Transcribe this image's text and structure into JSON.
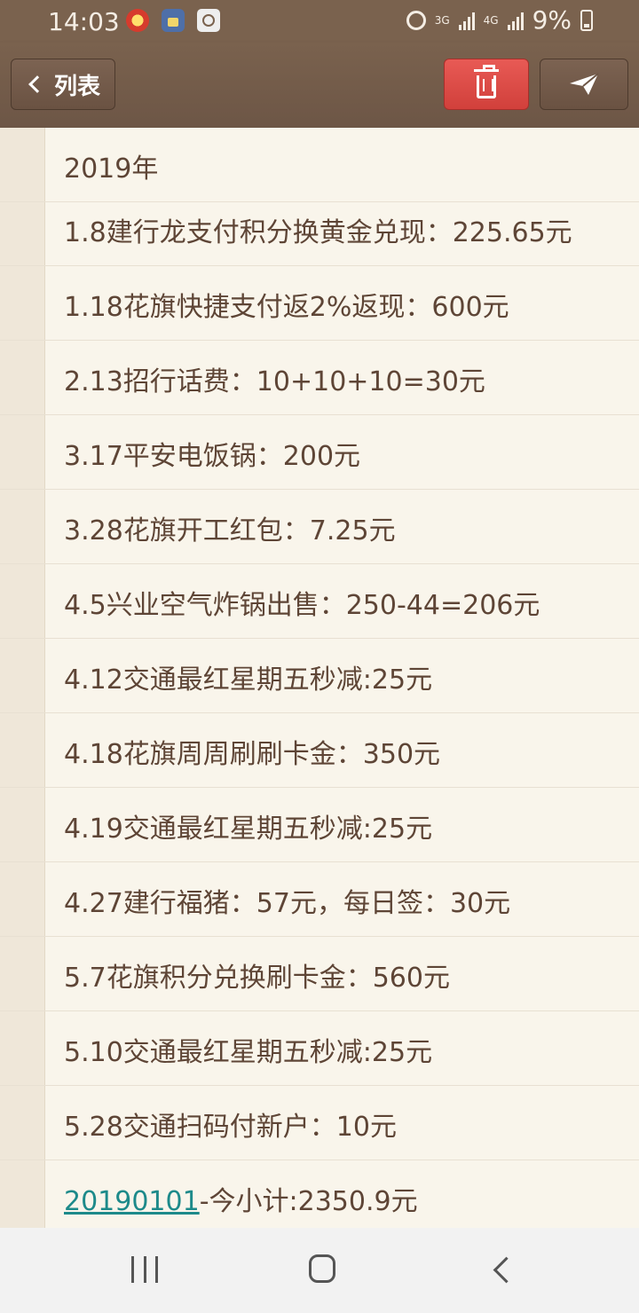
{
  "status_bar": {
    "time": "14:03",
    "network_3g": "3G",
    "network_4g": "4G",
    "battery": "9%"
  },
  "toolbar": {
    "back_label": "列表"
  },
  "note": {
    "lines": [
      "2019年",
      "1.8建行龙支付积分换黄金兑现：225.65元",
      "1.18花旗快捷支付返2%返现：600元",
      "2.13招行话费：10+10+10=30元",
      "3.17平安电饭锅：200元",
      "3.28花旗开工红包：7.25元",
      "4.5兴业空气炸锅出售：250-44=206元",
      "4.12交通最红星期五秒减:25元",
      "4.18花旗周周刷刷卡金：350元",
      "4.19交通最红星期五秒减:25元",
      "4.27建行福猪：57元，每日签：30元",
      "5.7花旗积分兑换刷卡金：560元",
      "5.10交通最红星期五秒减:25元",
      "5.28交通扫码付新户：10元"
    ],
    "summary_link": "20190101",
    "summary_rest": "-今小计:2350.9元"
  },
  "colors": {
    "toolbar": "#7a624e",
    "delete": "#e0514c",
    "text": "#5e4536",
    "link": "#1d8a8a"
  }
}
